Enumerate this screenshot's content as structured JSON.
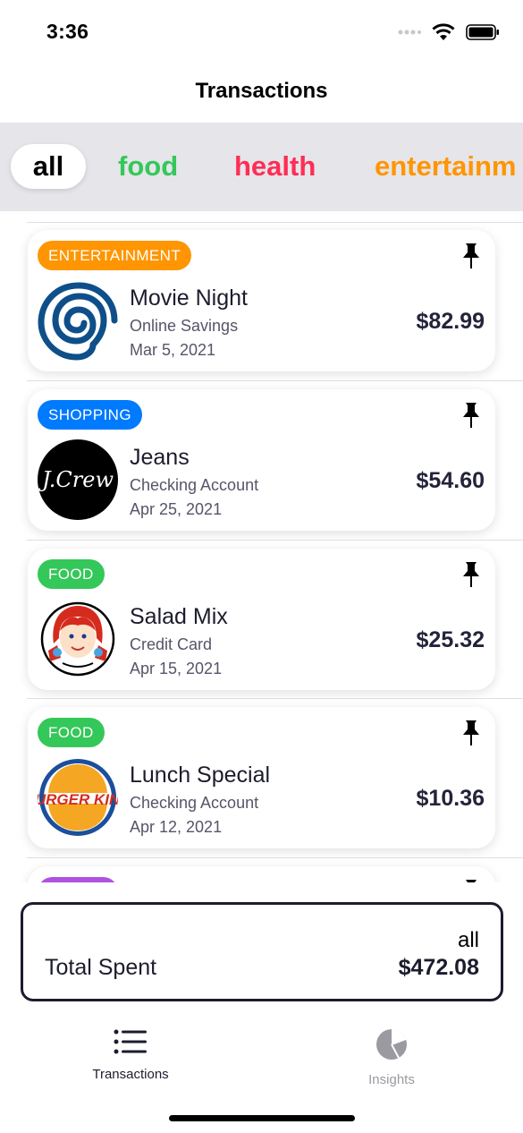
{
  "status_bar": {
    "time": "3:36"
  },
  "nav": {
    "title": "Transactions"
  },
  "filters": [
    {
      "label": "all",
      "color": "#000000"
    },
    {
      "label": "food",
      "color": "#34c759"
    },
    {
      "label": "health",
      "color": "#ff2d55"
    },
    {
      "label": "entertainm",
      "color": "#ff9500"
    }
  ],
  "transactions": [
    {
      "category": "ENTERTAINMENT",
      "category_color": "#ff9500",
      "logo": "time-warner-swirl-icon",
      "name": "Movie Night",
      "account": "Online Savings",
      "date": "Mar 5, 2021",
      "amount": "$82.99"
    },
    {
      "category": "SHOPPING",
      "category_color": "#007aff",
      "logo": "jcrew-logo-icon",
      "logo_text": "J.Crew",
      "name": "Jeans",
      "account": "Checking Account",
      "date": "Apr 25, 2021",
      "amount": "$54.60"
    },
    {
      "category": "FOOD",
      "category_color": "#34c759",
      "logo": "wendys-logo-icon",
      "name": "Salad Mix",
      "account": "Credit Card",
      "date": "Apr 15, 2021",
      "amount": "$25.32"
    },
    {
      "category": "FOOD",
      "category_color": "#34c759",
      "logo": "burger-king-logo-icon",
      "logo_text": "BURGER KING",
      "name": "Lunch Special",
      "account": "Checking Account",
      "date": "Apr 12, 2021",
      "amount": "$10.36"
    },
    {
      "category": "",
      "category_color": "#af52de",
      "logo": "",
      "name": "",
      "account": "",
      "date": "",
      "amount": ""
    }
  ],
  "summary": {
    "filter": "all",
    "label": "Total Spent",
    "amount": "$472.08"
  },
  "tabs": [
    {
      "label": "Transactions",
      "icon": "list-icon",
      "active": true
    },
    {
      "label": "Insights",
      "icon": "pie-chart-icon",
      "active": false
    }
  ]
}
